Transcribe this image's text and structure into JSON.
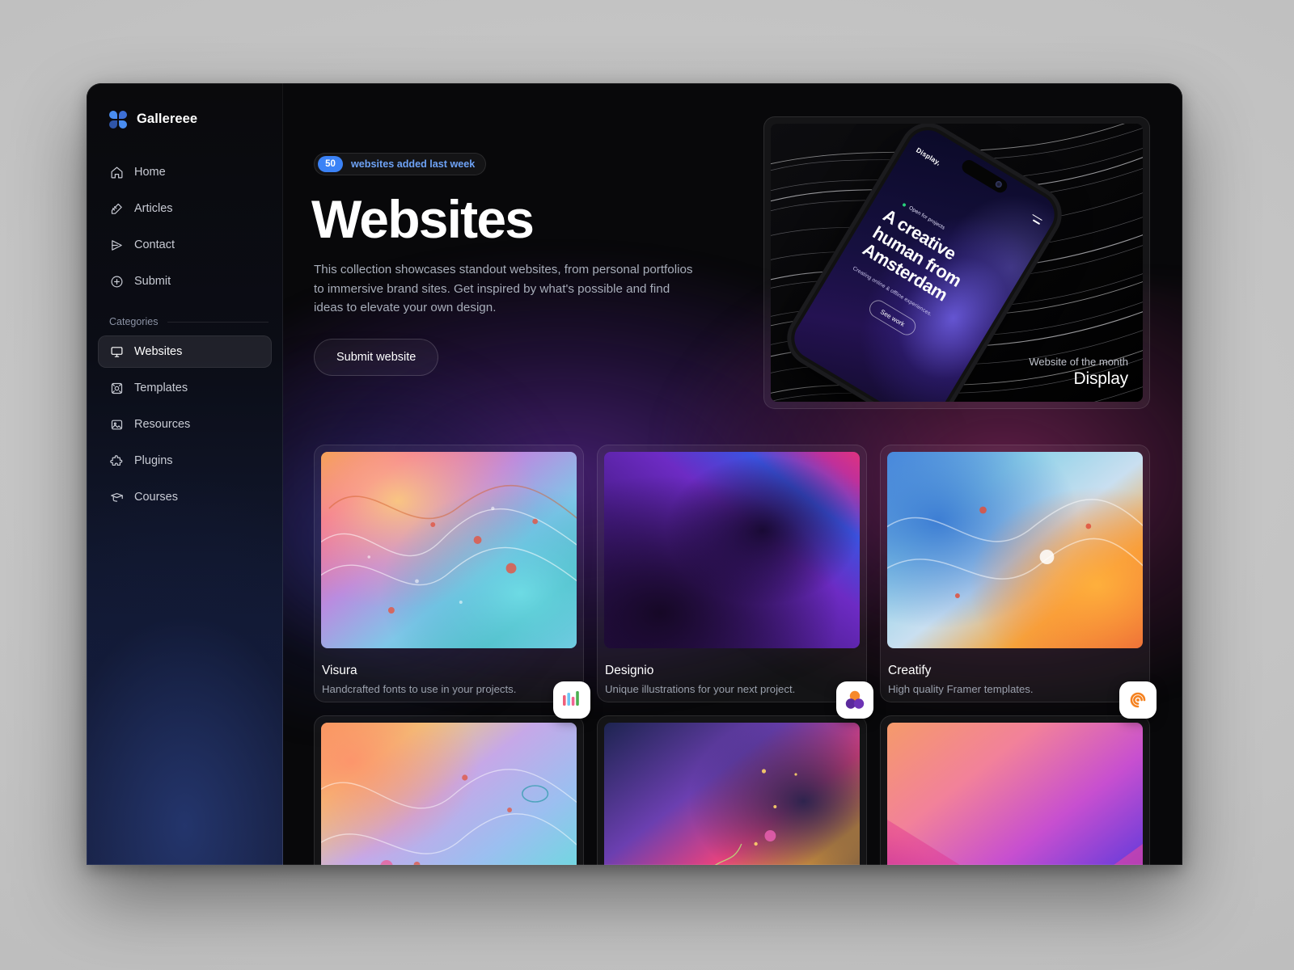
{
  "brand": {
    "name": "Gallereee",
    "logo_icon": "clover-logo-icon",
    "accent": "#3b82f6"
  },
  "sidebar": {
    "nav": [
      {
        "label": "Home",
        "icon": "home-icon"
      },
      {
        "label": "Articles",
        "icon": "pencil-lines-icon"
      },
      {
        "label": "Contact",
        "icon": "send-icon"
      },
      {
        "label": "Submit",
        "icon": "plus-circle-icon"
      }
    ],
    "categories_label": "Categories",
    "categories": [
      {
        "label": "Websites",
        "icon": "monitor-icon",
        "active": true
      },
      {
        "label": "Templates",
        "icon": "frame-icon",
        "active": false
      },
      {
        "label": "Resources",
        "icon": "image-icon",
        "active": false
      },
      {
        "label": "Plugins",
        "icon": "puzzle-icon",
        "active": false
      },
      {
        "label": "Courses",
        "icon": "graduation-cap-icon",
        "active": false
      }
    ]
  },
  "hero": {
    "badge_count": "50",
    "badge_text": "websites added last week",
    "title": "Websites",
    "description": "This collection showcases standout websites, from personal portfolios to immersive brand sites. Get inspired by what's possible and find ideas to elevate your own design.",
    "cta_label": "Submit website"
  },
  "featured": {
    "kicker": "Website of the month",
    "name": "Display",
    "phone": {
      "logo": "Display,",
      "status": "Open for projects",
      "headline": "A creative human from Amsterdam",
      "subline": "Creating online & offline experiences.",
      "cta": "See work"
    }
  },
  "grid": {
    "row1": [
      {
        "title": "Visura",
        "description": "Handcrafted fonts to use in your projects.",
        "icon": "bar-chart-icon"
      },
      {
        "title": "Designio",
        "description": "Unique illustrations for your next project.",
        "icon": "three-circles-icon"
      },
      {
        "title": "Creatify",
        "description": "High quality Framer templates.",
        "icon": "spiral-icon"
      }
    ],
    "row2": [
      {
        "title": "",
        "description": "",
        "icon": ""
      },
      {
        "title": "",
        "description": "",
        "icon": ""
      },
      {
        "title": "",
        "description": "",
        "icon": ""
      }
    ]
  }
}
